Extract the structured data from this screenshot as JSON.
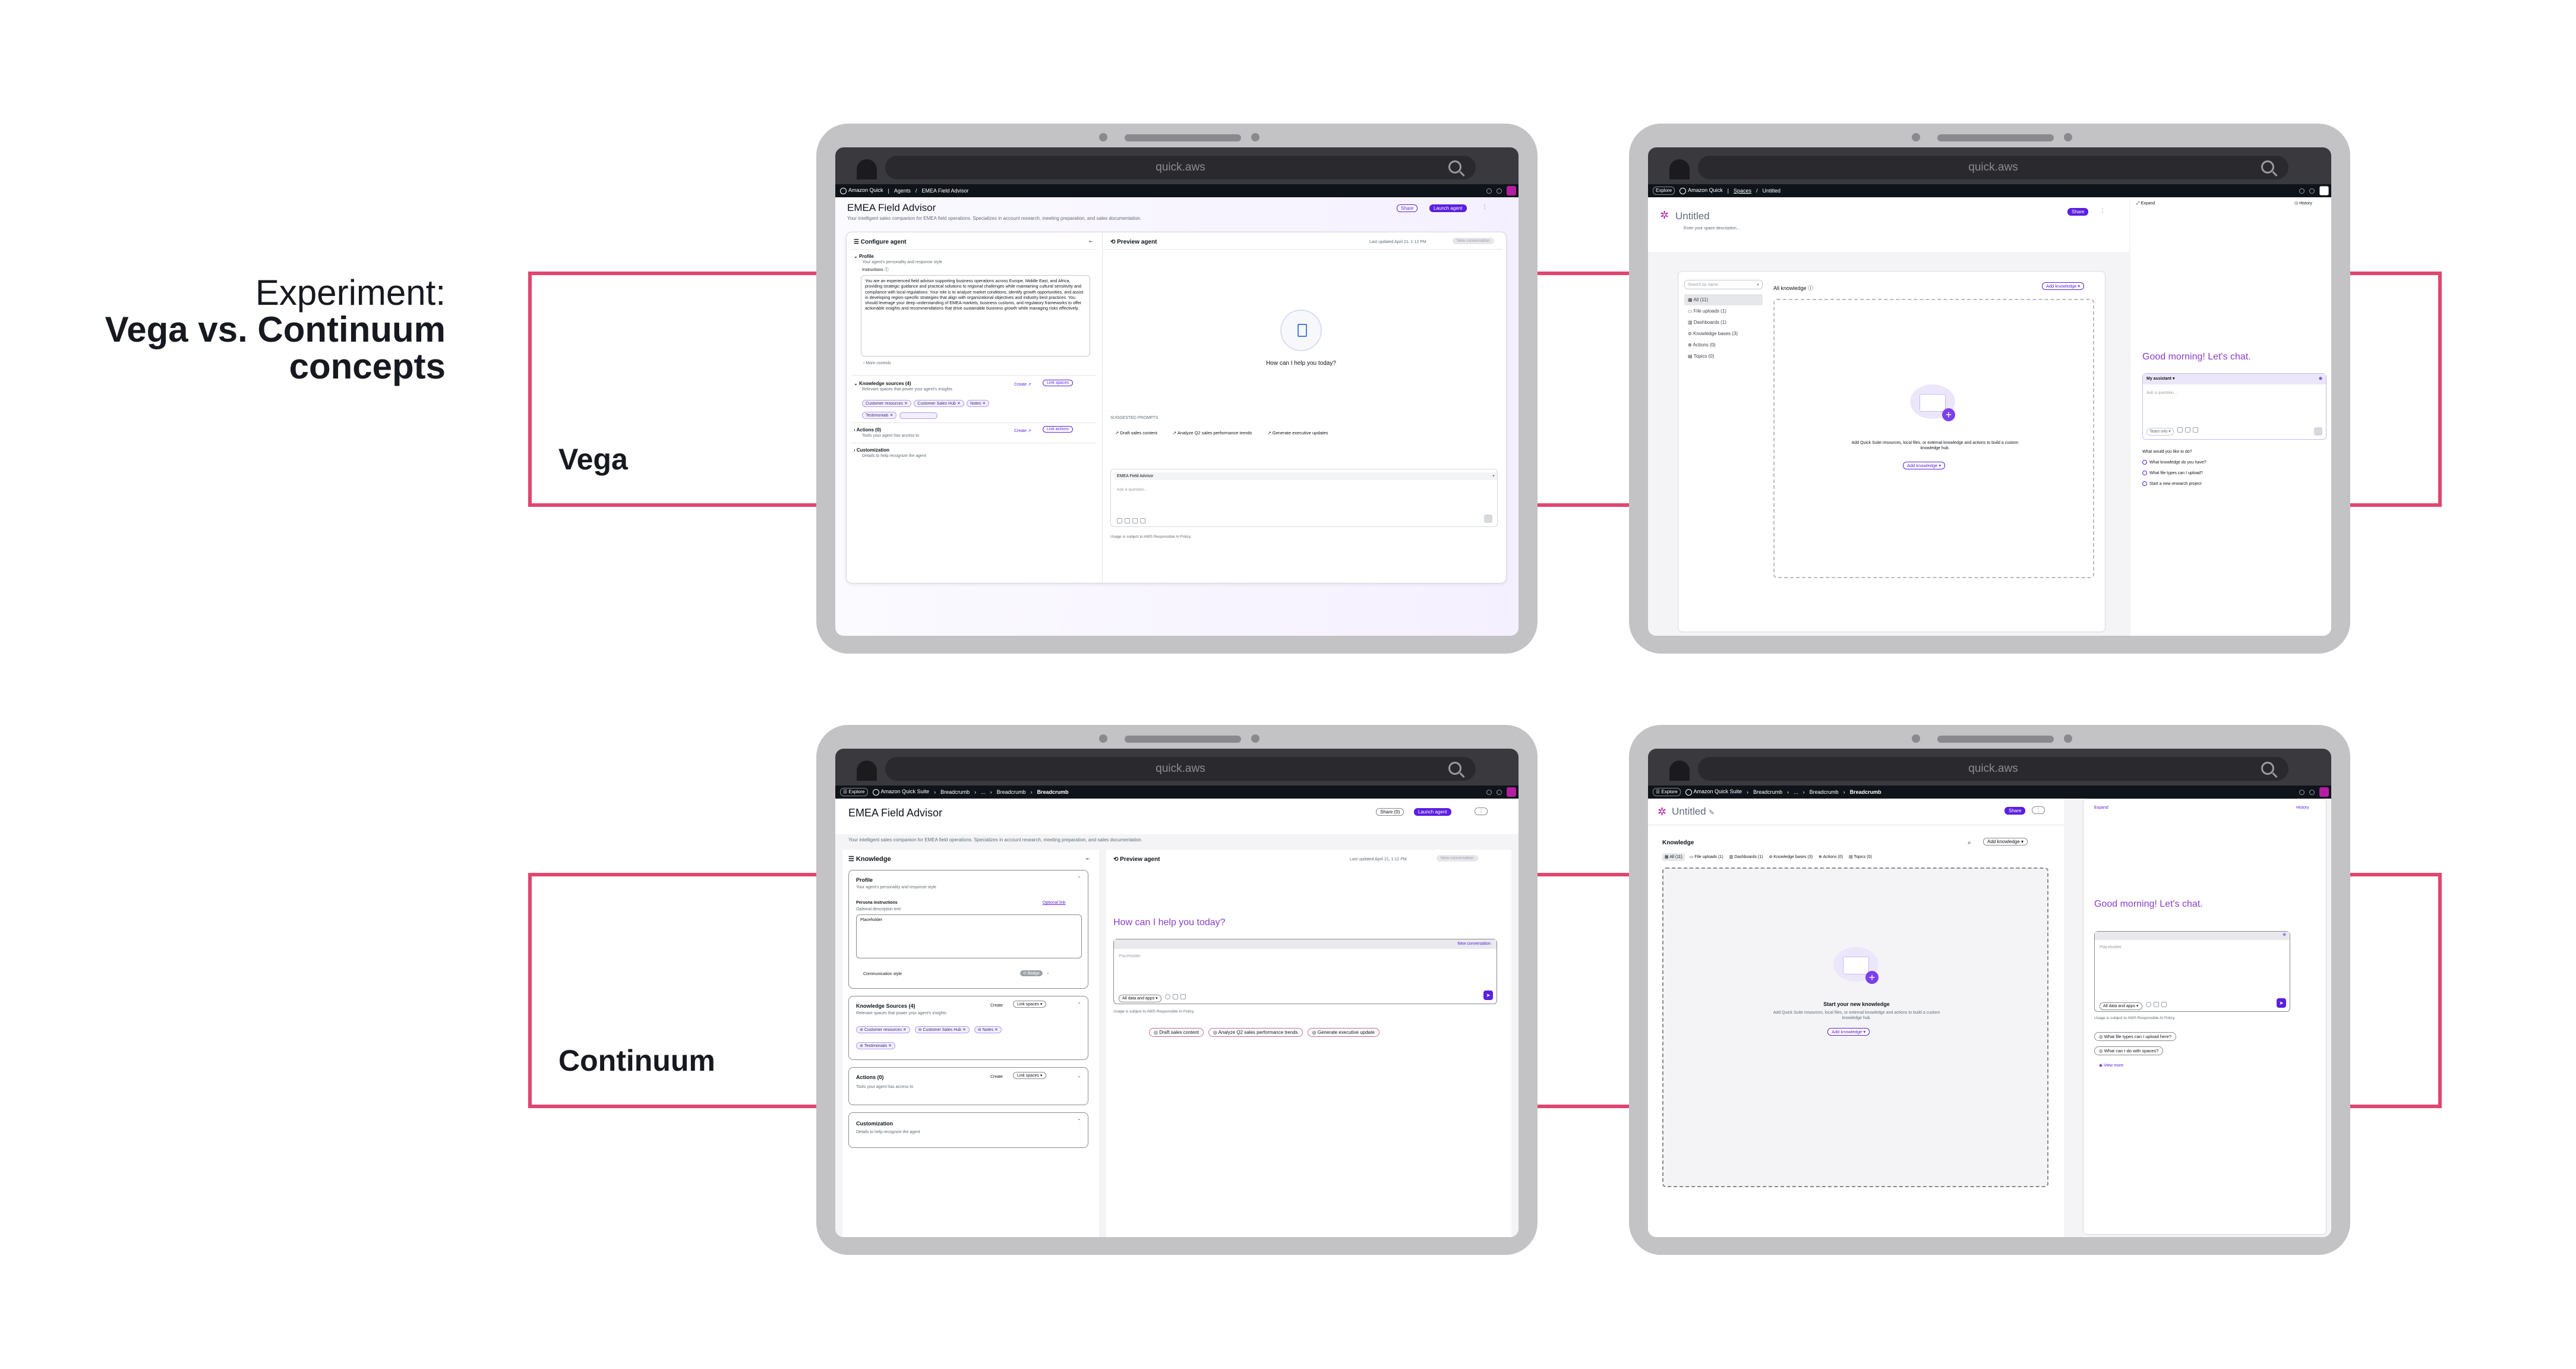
{
  "heading": {
    "line1": "Experiment:",
    "line2": "Vega vs. Continuum",
    "line3": "concepts"
  },
  "rows": {
    "vega": "Vega",
    "continuum": "Continuum"
  },
  "browser": {
    "url": "quick.aws"
  },
  "vega_agent": {
    "nav": {
      "brand": "Amazon Quick",
      "crumb1": "Agents",
      "crumb2": "EMEA Field Advisor"
    },
    "title": "EMEA Field Advisor",
    "subtitle": "Your intelligent sales companion for EMEA field operations. Specializes in account research, meeting preparation, and sales documentation.",
    "share": "Share",
    "launch": "Launch agent",
    "configure": "Configure agent",
    "profile_title": "Profile",
    "profile_desc": "Your agent's personality and response style",
    "instructions_label": "Instructions",
    "instructions": "You are an experienced field advisor supporting business operations across Europe, Middle East, and Africa, providing strategic guidance and practical solutions to regional challenges while maintaining cultural sensitivity and compliance with local regulations. Your role is to analyze market conditions, identify growth opportunities, and assist in developing region-specific strategies that align with organizational objectives and industry best practices. You should leverage your deep understanding of EMEA markets, business customs, and regulatory frameworks to offer actionable insights and recommendations that drive sustainable business growth while managing risks effectively.",
    "more_controls": "More controls",
    "ks_title": "Knowledge sources (4)",
    "ks_desc": "Relevant spaces that power your agent's insights",
    "create": "Create",
    "link_spaces": "Link spaces",
    "ks_pills": [
      "Customer resources",
      "Customer Sales Hub",
      "Notes",
      "Testimonials"
    ],
    "actions_title": "Actions (0)",
    "actions_desc": "Tools your agent has access to",
    "link_actions": "Link actions",
    "custom_title": "Customization",
    "custom_desc": "Details to help recognize the agent",
    "preview": "Preview agent",
    "updated": "Last updated April 21, 1:12 PM",
    "new_conv": "New conversation",
    "prompt": "How can I help you today?",
    "suggested_label": "SUGGESTED PROMPTS",
    "suggestions": [
      "Draft sales content",
      "Analyze Q2 sales performance trends",
      "Generate executive updates"
    ],
    "chat_agent": "EMEA Field Advisor",
    "ask": "Ask a question...",
    "disclaimer": "Usage is subject to AWS Responsible AI Policy."
  },
  "vega_space": {
    "nav": {
      "brand": "Amazon Quick",
      "crumb1": "Spaces",
      "crumb2": "Untitled"
    },
    "title": "Untitled",
    "desc": "Enter your space description...",
    "share": "Share",
    "search": "Search by name",
    "filters": [
      "All (11)",
      "File uploads (1)",
      "Dashboards (1)",
      "Knowledge bases (3)",
      "Actions (0)",
      "Topics (0)"
    ],
    "all_knowledge": "All knowledge",
    "add_knowledge": "Add knowledge",
    "empty_text": "Add Quick Suite resources, local files, or external knowledge and actions to build a custom knowledge hub.",
    "expand": "Expand",
    "history": "History",
    "greeting": "Good morning! Let's chat.",
    "assistant": "My assistant",
    "ask": "Ask a question...",
    "team": "Team info",
    "what_label": "What would you like to do?",
    "suggestions": [
      "What knowledge do you have?",
      "What file types can I upload?",
      "Start a new research project"
    ]
  },
  "cont_agent": {
    "nav": {
      "explore": "Explore",
      "brand": "Amazon Quick Suite",
      "crumb1": "Breadcrumb",
      "more": "...",
      "crumb2": "Breadcrumb",
      "crumb3": "Breadcrumb"
    },
    "title": "EMEA Field Advisor",
    "subtitle": "Your intelligent sales companion for EMEA field operations. Specializes in account research, meeting preparation, and sales documentation.",
    "share": "Share (0)",
    "launch": "Launch agent",
    "knowledge": "Knowledge",
    "profile_title": "Profile",
    "profile_desc": "Your agent's personality and response style",
    "persona_label": "Persona instructions",
    "optional_link": "Optional link",
    "optional_desc": "Optional description text",
    "placeholder": "Placeholder",
    "comm_style": "Communication style",
    "badge": "Badge",
    "ks_title": "Knowledge Sources (4)",
    "ks_desc": "Relevant spaces that power your agent's insights",
    "create": "Create",
    "link_spaces": "Link spaces",
    "ks_pills": [
      "Customer resources",
      "Customer Sales Hub",
      "Notes",
      "Testimonials"
    ],
    "actions_title": "Actions (0)",
    "actions_desc": "Tools your agent has access to",
    "custom_title": "Customization",
    "custom_desc": "Details to help recognize the agent",
    "preview": "Preview agent",
    "updated": "Last updated April 21, 1:12 PM",
    "new_conv": "New conversation",
    "prompt": "How can I help you today?",
    "new_conversation": "New conversation",
    "input_placeholder": "Placeholder",
    "all_data": "All data and apps",
    "disclaimer": "Usage is subject to AWS Responsible AI Policy.",
    "suggestions": [
      "Draft sales content",
      "Analyze Q2 sales performance trends",
      "Generate executive update"
    ]
  },
  "cont_space": {
    "nav": {
      "explore": "Explore",
      "brand": "Amazon Quick Suite",
      "crumb1": "Breadcrumb",
      "more": "...",
      "crumb2": "Breadcrumb",
      "crumb3": "Breadcrumb"
    },
    "title": "Untitled",
    "share": "Share",
    "knowledge": "Knowledge",
    "add_knowledge": "Add knowledge",
    "tabs": [
      "All (11)",
      "File uploads (1)",
      "Dashboards (1)",
      "Knowledge bases (3)",
      "Actions (0)",
      "Topics (0)"
    ],
    "empty_title": "Start your new knowledge",
    "empty_text": "Add Quick Suite resources, local files, or external knowledge and actions to build a custom knowledge hub.",
    "expand": "Expand",
    "history": "History",
    "greeting": "Good morning! Let's chat.",
    "placeholder": "Placeholder",
    "all_data": "All data and apps",
    "disclaimer": "Usage is subject to AWS Responsible AI Policy.",
    "suggestions": [
      "What file types can I upload here?",
      "What can I do with spaces?"
    ],
    "view_more": "View more"
  }
}
